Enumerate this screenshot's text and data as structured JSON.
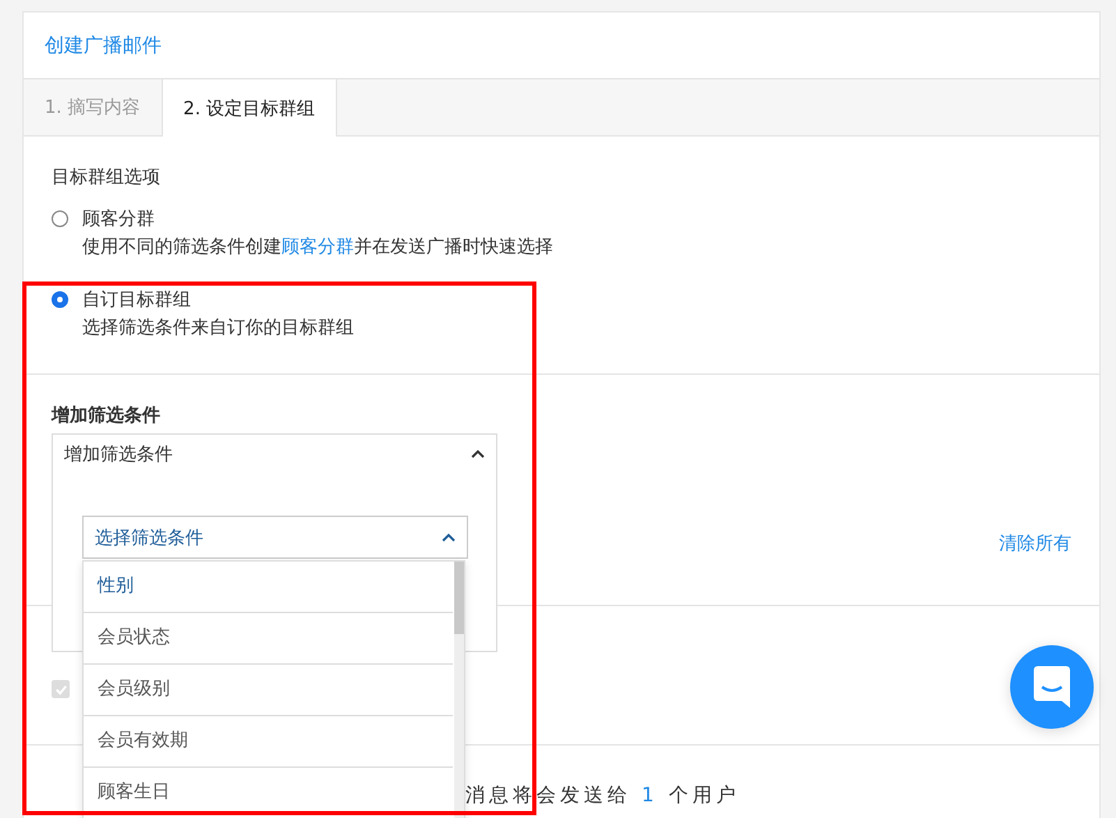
{
  "header": {
    "title": "创建广播邮件"
  },
  "tabs": [
    {
      "label": "1. 摘写内容",
      "selected": false
    },
    {
      "label": "2. 设定目标群组",
      "selected": true
    }
  ],
  "target_options": {
    "label": "目标群组选项",
    "options": [
      {
        "label": "顾客分群",
        "selected": false,
        "description": [
          {
            "kind": "text",
            "text": "使用不同的筛选条件创建"
          },
          {
            "kind": "link",
            "text": "顾客分群"
          },
          {
            "kind": "text",
            "text": "并在发送广播时快速选择"
          }
        ]
      },
      {
        "label": "自订目标群组",
        "selected": true,
        "description": [
          {
            "kind": "text",
            "text": "选择筛选条件来自订你的目标群组"
          }
        ]
      }
    ]
  },
  "filters": {
    "label": "增加筛选条件",
    "select_text": "增加筛选条件",
    "expanded": true,
    "sub_select": {
      "text": "选择筛选条件",
      "expanded": true,
      "options": [
        {
          "label": "性别",
          "selected": true
        },
        {
          "label": "会员状态",
          "selected": false
        },
        {
          "label": "会员级别",
          "selected": false
        },
        {
          "label": "会员有效期",
          "selected": false
        },
        {
          "label": "顾客生日",
          "selected": false
        }
      ]
    },
    "clear_all": "清除所有"
  },
  "checkbox": {
    "checked": true,
    "disabled": true
  },
  "recipients": {
    "before": "消息将会发送给 ",
    "count": "1",
    "after": " 个用户"
  },
  "highlight": {
    "visible": true
  }
}
